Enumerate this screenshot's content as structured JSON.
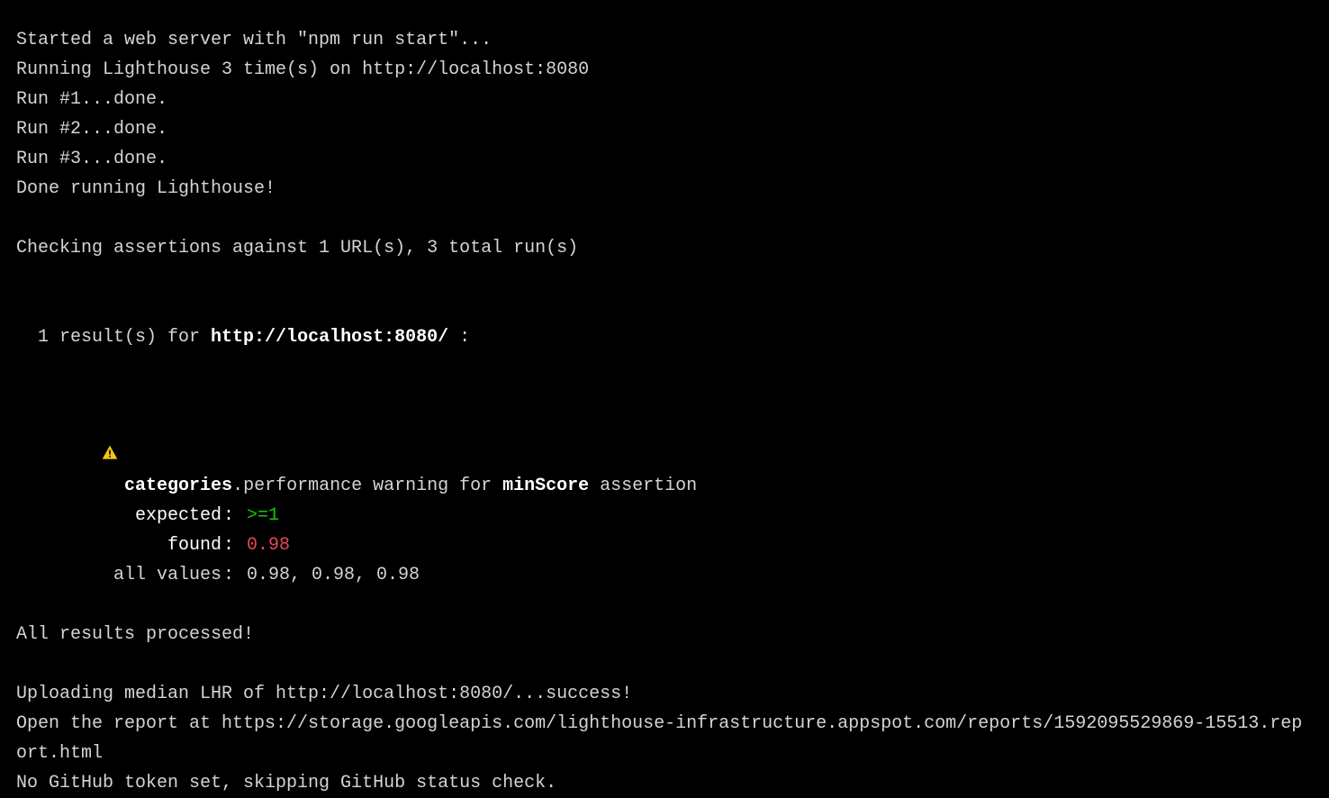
{
  "lines": {
    "l1": "Started a web server with \"npm run start\"...",
    "l2": "Running Lighthouse 3 time(s) on http://localhost:8080",
    "l3": "Run #1...done.",
    "l4": "Run #2...done.",
    "l5": "Run #3...done.",
    "l6": "Done running Lighthouse!",
    "l7": "Checking assertions against 1 URL(s), 3 total run(s)",
    "l8_prefix": "1 result(s) for ",
    "l8_url": "http://localhost:8080/",
    "l8_suffix": " :",
    "l9": "All results processed!",
    "l10": "Uploading median LHR of http://localhost:8080/...success!",
    "l11": "Open the report at https://storage.googleapis.com/lighthouse-infrastructure.appspot.com/reports/1592095529869-15513.report.html",
    "l12": "No GitHub token set, skipping GitHub status check."
  },
  "assertion": {
    "category_bold": "categories",
    "category_rest": ".performance warning for ",
    "min_bold": "minScore",
    "suffix": " assertion",
    "expected_label": "expected",
    "expected_value": ">=1",
    "found_label": "found",
    "found_value": "0.98",
    "all_label": "all values",
    "all_value": "0.98, 0.98, 0.98"
  },
  "sep": ": "
}
